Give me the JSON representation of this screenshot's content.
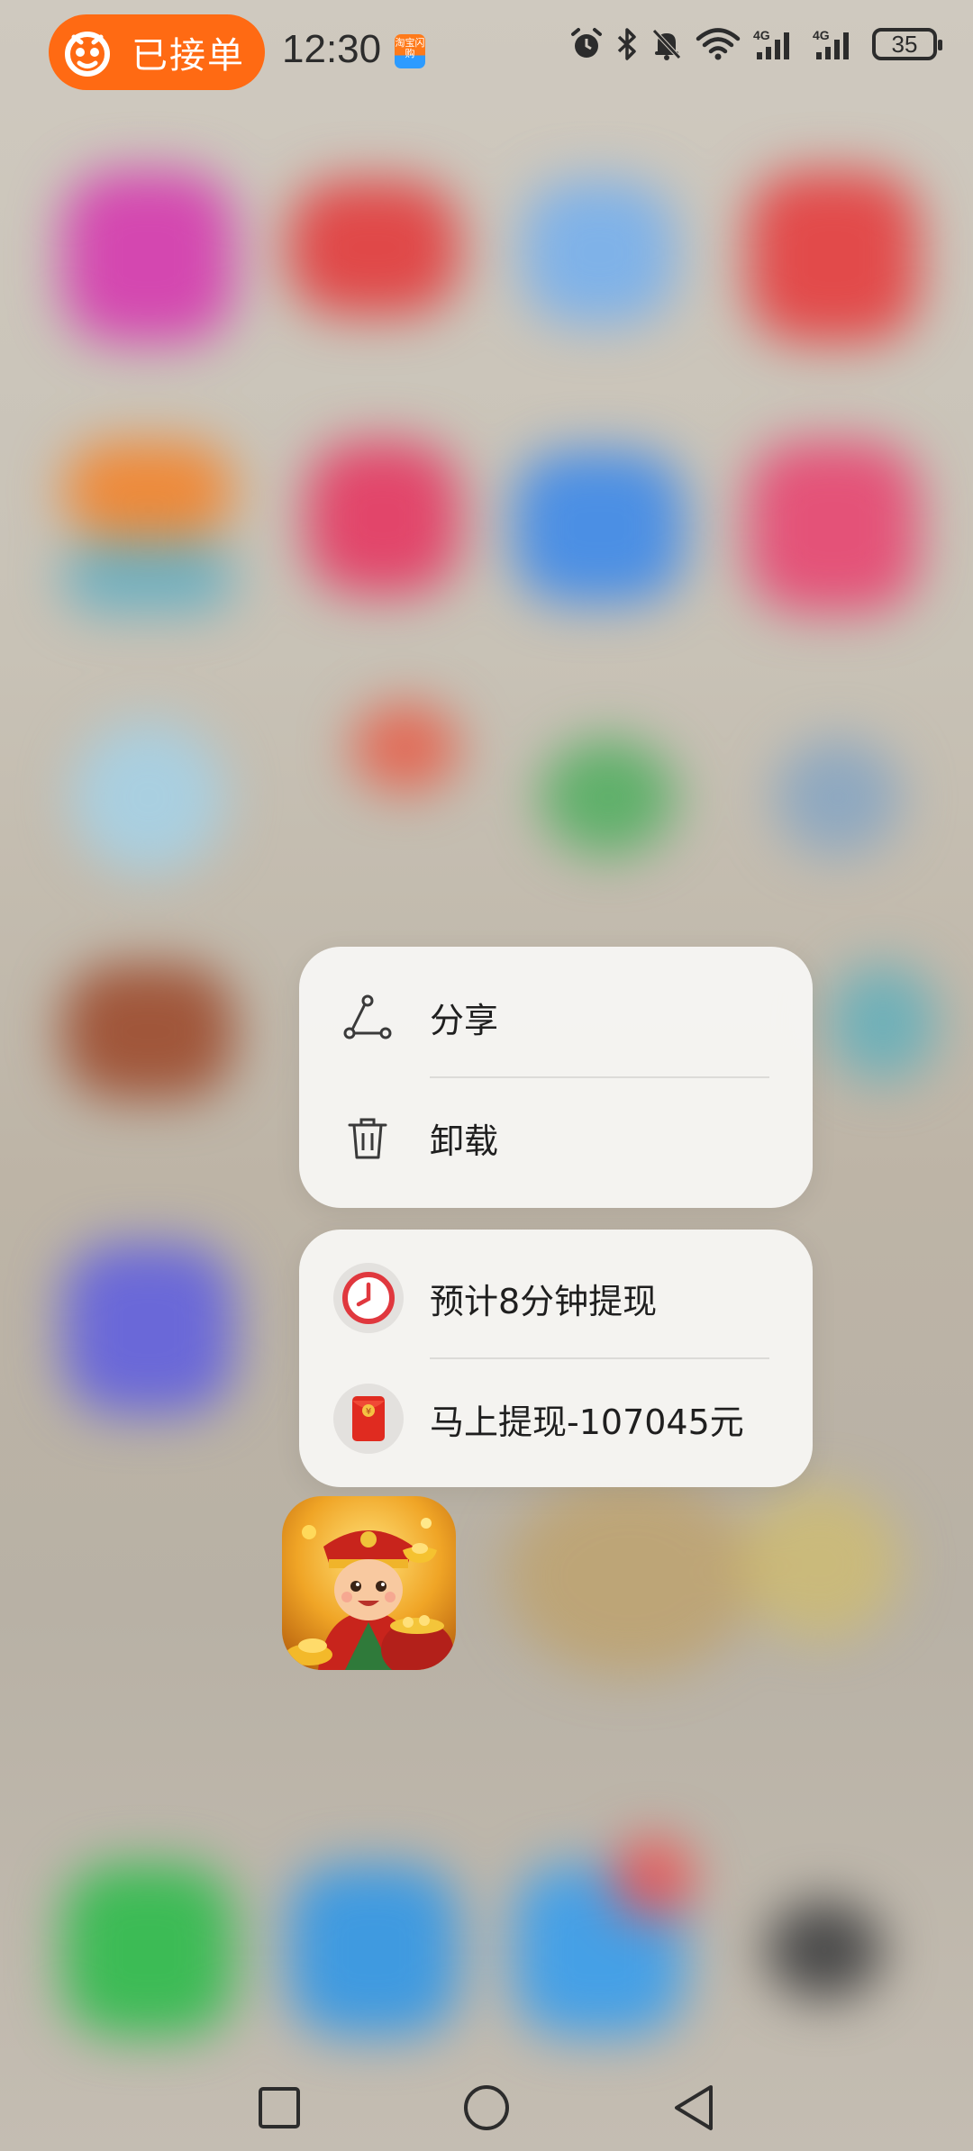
{
  "status_bar": {
    "order_status": "已接单",
    "time": "12:30",
    "notification_app_icon": "taobao-flash-icon",
    "notification_app_text": "淘宝闪购",
    "battery_level": "35",
    "indicators": [
      "alarm-icon",
      "bluetooth-icon",
      "mute-bell-icon",
      "wifi-icon",
      "4g-signal-icon",
      "4g-signal-icon"
    ],
    "signal_1_label": "4G",
    "signal_2_label": "4G"
  },
  "menu": {
    "actions": [
      {
        "label": "分享",
        "icon": "share-icon"
      },
      {
        "label": "卸载",
        "icon": "trash-icon"
      }
    ],
    "shortcuts": [
      {
        "label": "预计8分钟提现",
        "icon": "clock-icon"
      },
      {
        "label": "马上提现-107045元",
        "icon": "red-envelope-icon"
      }
    ]
  },
  "app": {
    "icon": "fortune-god-app-icon"
  },
  "nav": {
    "buttons": [
      "recents-square-icon",
      "home-circle-icon",
      "back-triangle-icon"
    ]
  },
  "colors": {
    "accent_orange": "#ff6a13",
    "menu_bg": "#f6f5f3",
    "clock_red": "#e0383e",
    "envelope_red": "#e02b20"
  }
}
